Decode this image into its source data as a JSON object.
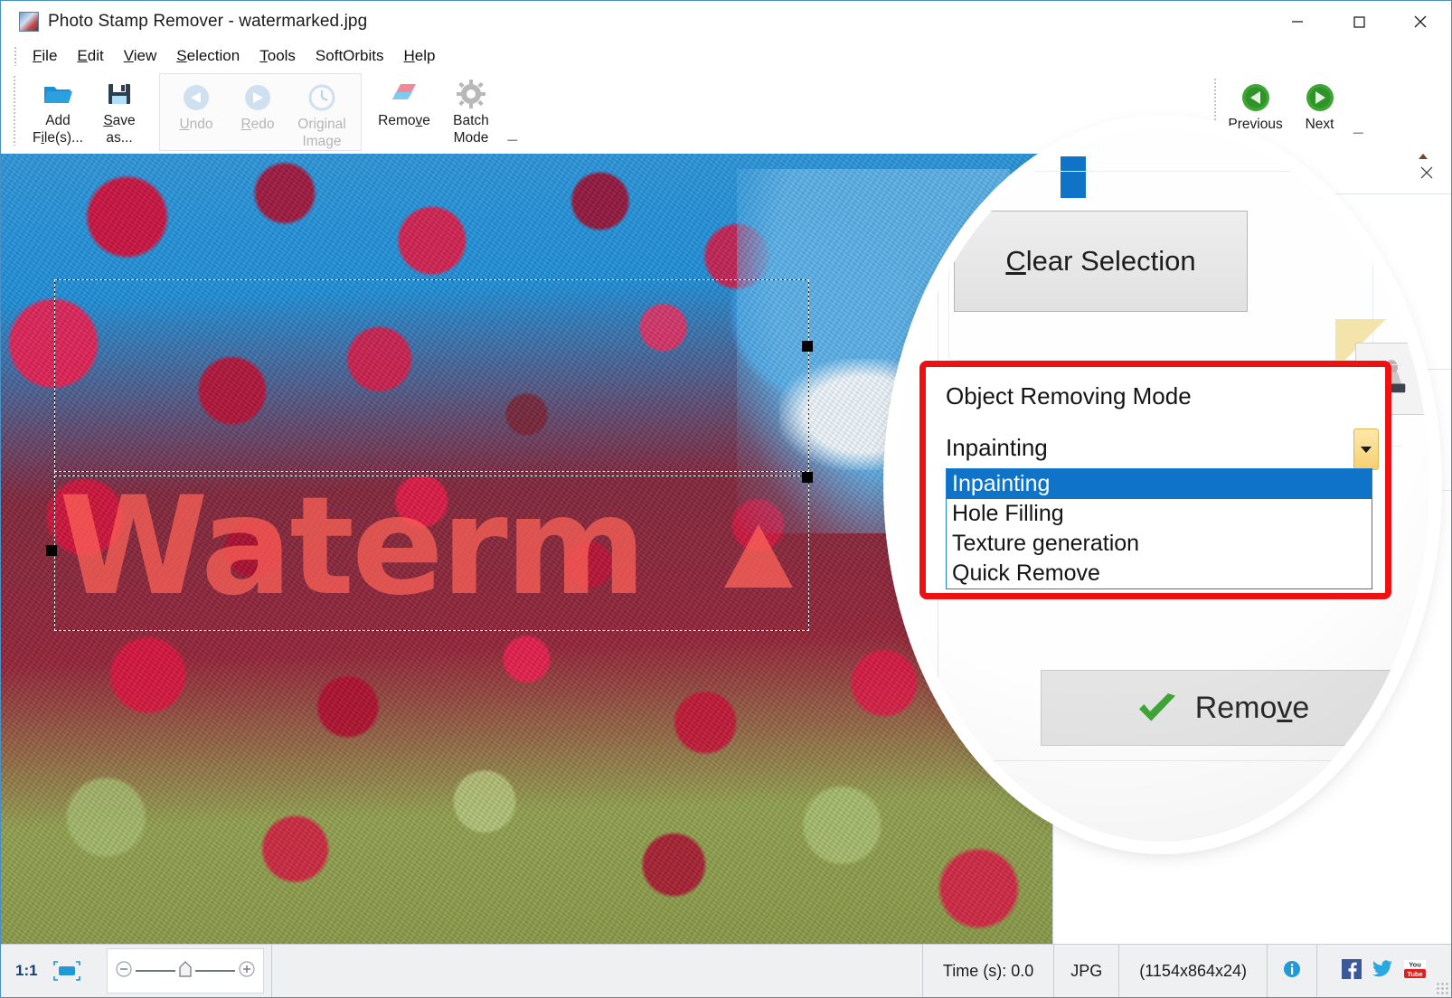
{
  "window": {
    "title": "Photo Stamp Remover - watermarked.jpg",
    "app_icon": "app-photo-icon",
    "minimize": "—",
    "maximize": "□",
    "close": "✕"
  },
  "menu": {
    "items": [
      {
        "label": "File",
        "accel": "F"
      },
      {
        "label": "Edit",
        "accel": "E"
      },
      {
        "label": "View",
        "accel": "V"
      },
      {
        "label": "Selection",
        "accel": "S"
      },
      {
        "label": "Tools",
        "accel": "T"
      },
      {
        "label": "SoftOrbits",
        "accel": ""
      },
      {
        "label": "Help",
        "accel": "H"
      }
    ]
  },
  "toolbar": {
    "add_files": {
      "line1": "Add",
      "line2": "File(s)...",
      "icon": "open-folder-icon"
    },
    "save_as": {
      "line1": "Save",
      "line2": "as...",
      "icon": "floppy-disk-icon"
    },
    "undo": {
      "label": "Undo",
      "icon": "undo-arrow-icon",
      "disabled": true
    },
    "redo": {
      "label": "Redo",
      "icon": "redo-arrow-icon",
      "disabled": true
    },
    "original_image": {
      "line1": "Original",
      "line2": "Image",
      "icon": "clock-history-icon",
      "disabled": true
    },
    "remove": {
      "label": "Remove",
      "icon": "eraser-icon"
    },
    "batch_mode": {
      "line1": "Batch",
      "line2": "Mode",
      "icon": "gear-icon"
    },
    "overflow": "▾",
    "previous": {
      "label": "Previous",
      "icon": "green-left-arrow-icon"
    },
    "next": {
      "label": "Next",
      "icon": "green-right-arrow-icon"
    }
  },
  "canvas": {
    "watermark_text": "Waterm",
    "watermark_color": "#ff6358",
    "selection_label": "selection-marquee"
  },
  "panel": {
    "close_icon": "✕",
    "clear_selection": "Clear Selection",
    "clear_selection_accel": "C",
    "remove_button": "Remove",
    "remove_button_accel": "v",
    "stamp_tool_icon": "stamp-tool-icon"
  },
  "callout": {
    "border_color": "#ef1111",
    "title": "Object Removing Mode",
    "selected_value": "Inpainting",
    "options": [
      "Inpainting",
      "Hole Filling",
      "Texture generation",
      "Quick Remove"
    ],
    "dropdown_arrow": "▼",
    "highlight_color": "#0f74c8"
  },
  "status_bar": {
    "zoom_ratio": "1:1",
    "fit_icon": "fit-to-window-icon",
    "zoom_out_icon": "zoom-out-icon",
    "zoom_in_icon": "zoom-in-icon",
    "time": "Time (s): 0.0",
    "format": "JPG",
    "dimensions": "(1154x864x24)",
    "info_icon": "info-icon",
    "facebook_icon": "facebook-icon",
    "twitter_icon": "twitter-icon",
    "youtube_icon": "youtube-icon"
  }
}
